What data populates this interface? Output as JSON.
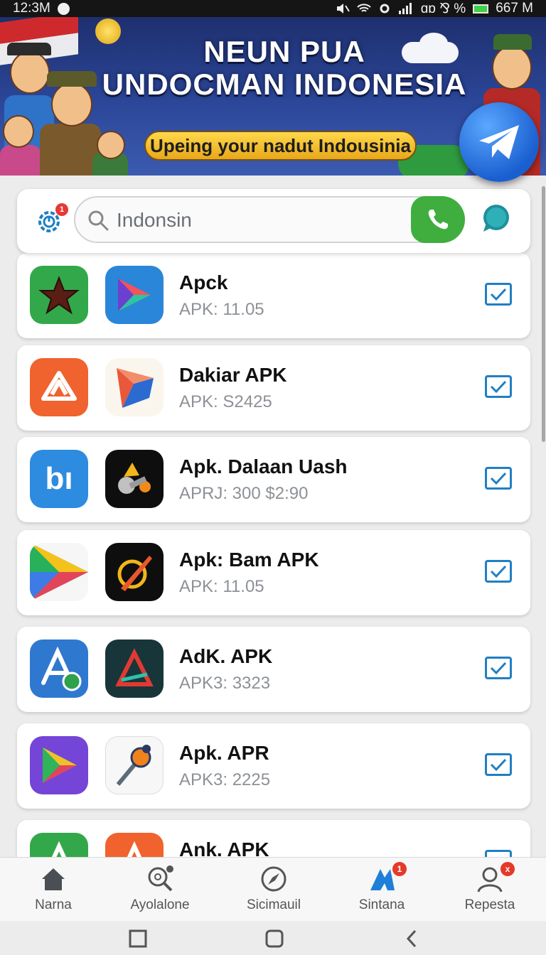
{
  "status_bar": {
    "time": "12:3M",
    "right_text": "ɑɒ ⅋ %",
    "battery_text": "667 M"
  },
  "banner": {
    "title_line1": "NEUN PUA",
    "title_line2": "UNDOCMAN INDONESIA",
    "subtitle": "Upeing your nadut Indousinia",
    "badge_icon": "telegram-plane-icon"
  },
  "search": {
    "value": "Indonsin",
    "notification_count": "1",
    "left_icon": "gear-timer-icon",
    "call_icon": "phone-icon",
    "chat_icon": "chat-bubble-icon"
  },
  "apps": [
    {
      "title": "Apck",
      "subtitle": "APK: 11.05"
    },
    {
      "title": "Dakiar APK",
      "subtitle": "APK: S2425"
    },
    {
      "title": "Apk. Dalaan Uash",
      "subtitle": "APRJ: 300  $2:90"
    },
    {
      "title": "Apk: Bam APK",
      "subtitle": "APK: 11.05"
    },
    {
      "title": "AdK. APK",
      "subtitle": "APK3: 3323"
    },
    {
      "title": "Apk. APR",
      "subtitle": "APK3: 2225"
    },
    {
      "title": "Ank. APK",
      "subtitle": ""
    }
  ],
  "bottom_nav": [
    {
      "label": "Narna",
      "icon": "home-icon"
    },
    {
      "label": "Ayolalone",
      "icon": "search-magnifier-icon"
    },
    {
      "label": "Sicimauil",
      "icon": "compass-icon"
    },
    {
      "label": "Sintana",
      "icon": "app-store-icon",
      "badge": "1"
    },
    {
      "label": "Repesta",
      "icon": "profile-icon",
      "badge": "x"
    }
  ],
  "colors": {
    "accent_blue": "#1f7fc4",
    "call_green": "#3fae3f",
    "badge_red": "#e53935",
    "banner_blue": "#2c4799"
  }
}
